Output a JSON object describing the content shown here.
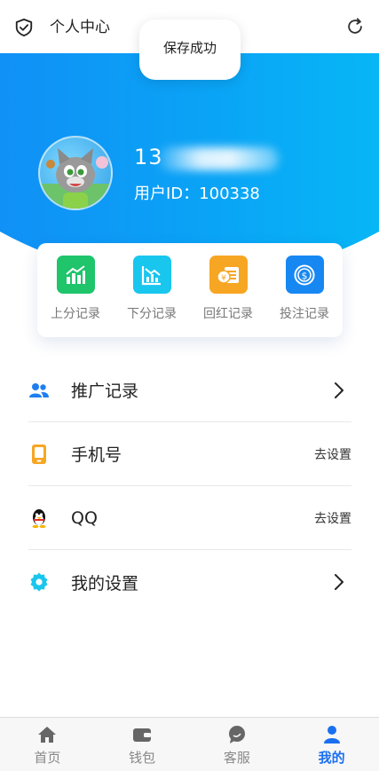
{
  "header": {
    "title": "个人中心",
    "left_icon": "shield-check-icon",
    "right_icon": "refresh-icon"
  },
  "toast": {
    "text": "保存成功"
  },
  "profile": {
    "phone": "13",
    "uid_label": "用户ID：100338",
    "avatar": "cartoon-cat-avatar"
  },
  "quick_actions": [
    {
      "label": "上分记录",
      "icon": "chart-up-icon",
      "color": "#1fc46b"
    },
    {
      "label": "下分记录",
      "icon": "chart-down-icon",
      "color": "#19c6ee"
    },
    {
      "label": "回红记录",
      "icon": "coin-note-icon",
      "color": "#f7a623"
    },
    {
      "label": "投注记录",
      "icon": "dollar-coin-icon",
      "color": "#1787f2"
    }
  ],
  "menu": [
    {
      "label": "推广记录",
      "icon": "users-icon",
      "right": ""
    },
    {
      "label": "手机号",
      "icon": "phone-icon",
      "right": "去设置"
    },
    {
      "label": "QQ",
      "icon": "qq-penguin-icon",
      "right": "去设置"
    },
    {
      "label": "我的设置",
      "icon": "gear-icon",
      "right": ""
    }
  ],
  "tabbar": [
    {
      "label": "首页",
      "icon": "home-icon",
      "active": false
    },
    {
      "label": "钱包",
      "icon": "wallet-icon",
      "active": false
    },
    {
      "label": "客服",
      "icon": "chat-icon",
      "active": false
    },
    {
      "label": "我的",
      "icon": "user-icon",
      "active": true
    }
  ],
  "colors": {
    "primary": "#1482f6",
    "accent_end": "#04c8f4",
    "tab_active": "#1a6ff0"
  }
}
